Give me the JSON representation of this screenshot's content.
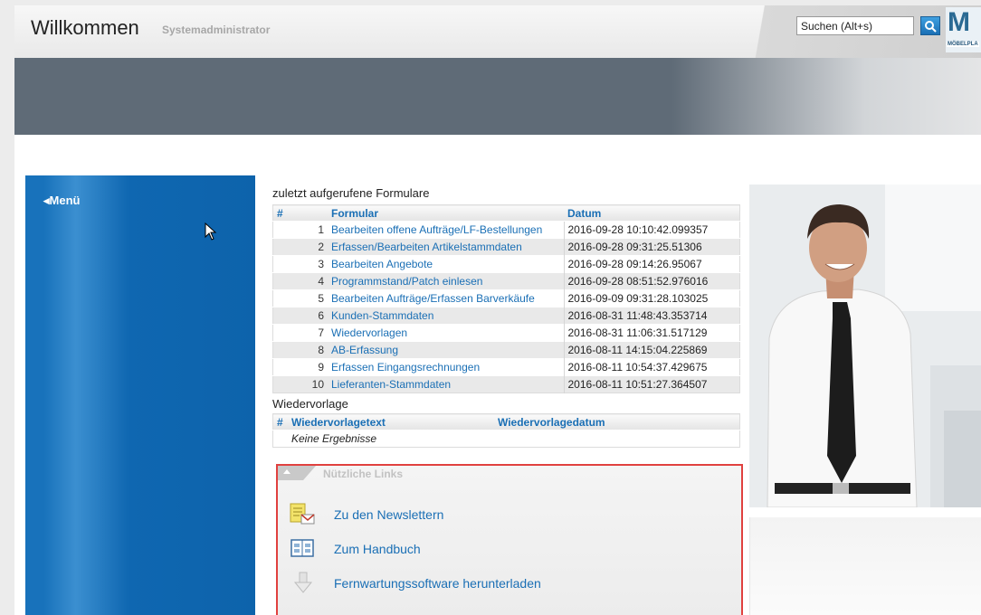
{
  "header": {
    "title": "Willkommen",
    "user": "Systemadministrator",
    "search": {
      "value": "Suchen (Alt+s)"
    },
    "logo": {
      "mark": "M",
      "text": "MÖBELPLA"
    }
  },
  "sidebar": {
    "menu_label": "Menü"
  },
  "recent_forms": {
    "title": "zuletzt aufgerufene Formulare",
    "columns": [
      "#",
      "Formular",
      "Datum"
    ],
    "rows": [
      {
        "n": "1",
        "form": "Bearbeiten offene Aufträge/LF-Bestellungen",
        "date": "2016-09-28 10:10:42.099357"
      },
      {
        "n": "2",
        "form": "Erfassen/Bearbeiten Artikelstammdaten",
        "date": "2016-09-28 09:31:25.51306"
      },
      {
        "n": "3",
        "form": "Bearbeiten Angebote",
        "date": "2016-09-28 09:14:26.95067"
      },
      {
        "n": "4",
        "form": "Programmstand/Patch einlesen",
        "date": "2016-09-28 08:51:52.976016"
      },
      {
        "n": "5",
        "form": "Bearbeiten Aufträge/Erfassen Barverkäufe",
        "date": "2016-09-09 09:31:28.103025"
      },
      {
        "n": "6",
        "form": "Kunden-Stammdaten",
        "date": "2016-08-31 11:48:43.353714"
      },
      {
        "n": "7",
        "form": "Wiedervorlagen",
        "date": "2016-08-31 11:06:31.517129"
      },
      {
        "n": "8",
        "form": "AB-Erfassung",
        "date": "2016-08-11 14:15:04.225869"
      },
      {
        "n": "9",
        "form": "Erfassen Eingangsrechnungen",
        "date": "2016-08-11 10:54:37.429675"
      },
      {
        "n": "10",
        "form": "Lieferanten-Stammdaten",
        "date": "2016-08-11 10:51:27.364507"
      }
    ]
  },
  "reminders": {
    "title": "Wiedervorlage",
    "columns": [
      "#",
      "Wiedervorlagetext",
      "Wiedervorlagedatum"
    ],
    "empty": "Keine Ergebnisse"
  },
  "useful_links": {
    "title": "Nützliche Links",
    "items": [
      {
        "label": "Zu den Newslettern",
        "icon": "newsletter-icon"
      },
      {
        "label": "Zum Handbuch",
        "icon": "handbook-icon"
      },
      {
        "label": "Fernwartungssoftware herunterladen",
        "icon": "download-icon"
      }
    ]
  },
  "colors": {
    "accent": "#1a6fb5",
    "sidebar": "#0f67b1",
    "banner": "#5f6b77",
    "highlight": "#e0413f"
  }
}
